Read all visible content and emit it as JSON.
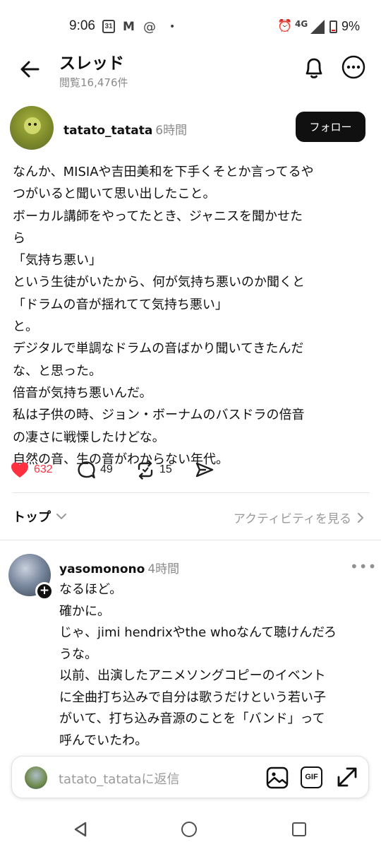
{
  "status_bar": {
    "time": "9:06",
    "calendar_day": "31",
    "network": "4G",
    "battery": "9%"
  },
  "header": {
    "title": "スレッド",
    "subtitle": "閲覧16,476件"
  },
  "post": {
    "username": "tatato_tatata",
    "time_ago": "6時間",
    "follow_label": "フォロー",
    "lines": [
      "なんか、MISIAや吉田美和を下手くそとか言ってるや",
      "つがいると聞いて思い出したこと。",
      "ボーカル講師をやってたとき、ジャニスを聞かせた",
      "ら",
      "「気持ち悪い」",
      "という生徒がいたから、何が気持ち悪いのか聞くと",
      "「ドラムの音が揺れてて気持ち悪い」",
      "と。",
      "デジタルで単調なドラムの音ばかり聞いてきたんだ",
      "な、と思った。",
      "倍音が気持ち悪いんだ。",
      "私は子供の時、ジョン・ボーナムのバスドラの倍音",
      "の凄さに戦慄したけどな。",
      "自然の音、生の音がわからない年代。"
    ],
    "likes": "632",
    "replies": "49",
    "reposts": "15",
    "like_color": "#ff3040"
  },
  "sort": {
    "label": "トップ",
    "activity_link": "アクティビティを見る"
  },
  "reply": {
    "username": "yasomonono",
    "time_ago": "4時間",
    "lines": [
      "なるほど。",
      "確かに。",
      "じゃ、jimi hendrixやthe whoなんて聴けんだろ",
      "うな。",
      "以前、出演したアニメソングコピーのイベント",
      "に全曲打ち込みで自分は歌うだけという若い子",
      "がいて、打ち込み音源のことを「バンド」って",
      "呼んでいたわ。"
    ]
  },
  "composer": {
    "placeholder": "tatato_tatataに返信",
    "gif_label": "GIF"
  }
}
